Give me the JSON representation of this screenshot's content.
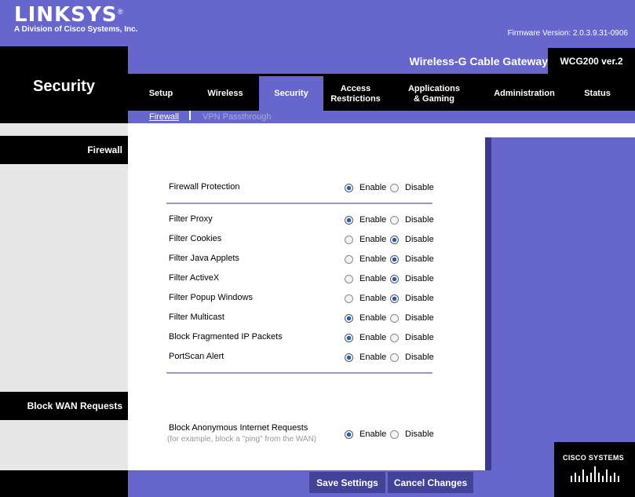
{
  "header": {
    "brand": "LINKSYS",
    "brand_reg": "®",
    "division": "A Division of Cisco Systems, Inc.",
    "firmware": "Firmware Version: 2.0.3.9.31-0906",
    "section_title": "Security",
    "product_name": "Wireless-G Cable Gateway",
    "model": "WCG200 ver.2"
  },
  "tabs": [
    {
      "label": "Setup"
    },
    {
      "label": "Wireless"
    },
    {
      "label": "Security",
      "active": true
    },
    {
      "label": "Access\nRestrictions"
    },
    {
      "label": "Applications\n& Gaming"
    },
    {
      "label": "Administration"
    },
    {
      "label": "Status"
    }
  ],
  "subnav": {
    "firewall": "Firewall",
    "vpn": "VPN Passthrough"
  },
  "sidebar": {
    "firewall": "Firewall",
    "block_wan": "Block WAN Requests"
  },
  "radio_labels": {
    "enable": "Enable",
    "disable": "Disable"
  },
  "settings": [
    {
      "label": "Firewall Protection",
      "value": "enable"
    },
    {
      "label": "Filter Proxy",
      "value": "enable"
    },
    {
      "label": "Filter Cookies",
      "value": "disable"
    },
    {
      "label": "Filter Java Applets",
      "value": "disable"
    },
    {
      "label": "Filter ActiveX",
      "value": "disable"
    },
    {
      "label": "Filter Popup Windows",
      "value": "disable"
    },
    {
      "label": "Filter Multicast",
      "value": "enable"
    },
    {
      "label": "Block Fragmented IP Packets",
      "value": "enable"
    },
    {
      "label": "PortScan Alert",
      "value": "enable"
    },
    {
      "label": "Block Anonymous Internet Requests",
      "value": "enable"
    }
  ],
  "block_note": "(for example, block a \"ping\" from the WAN)",
  "buttons": {
    "save": "Save Settings",
    "cancel": "Cancel Changes"
  },
  "footer": {
    "cisco": "CISCO SYSTEMS"
  }
}
